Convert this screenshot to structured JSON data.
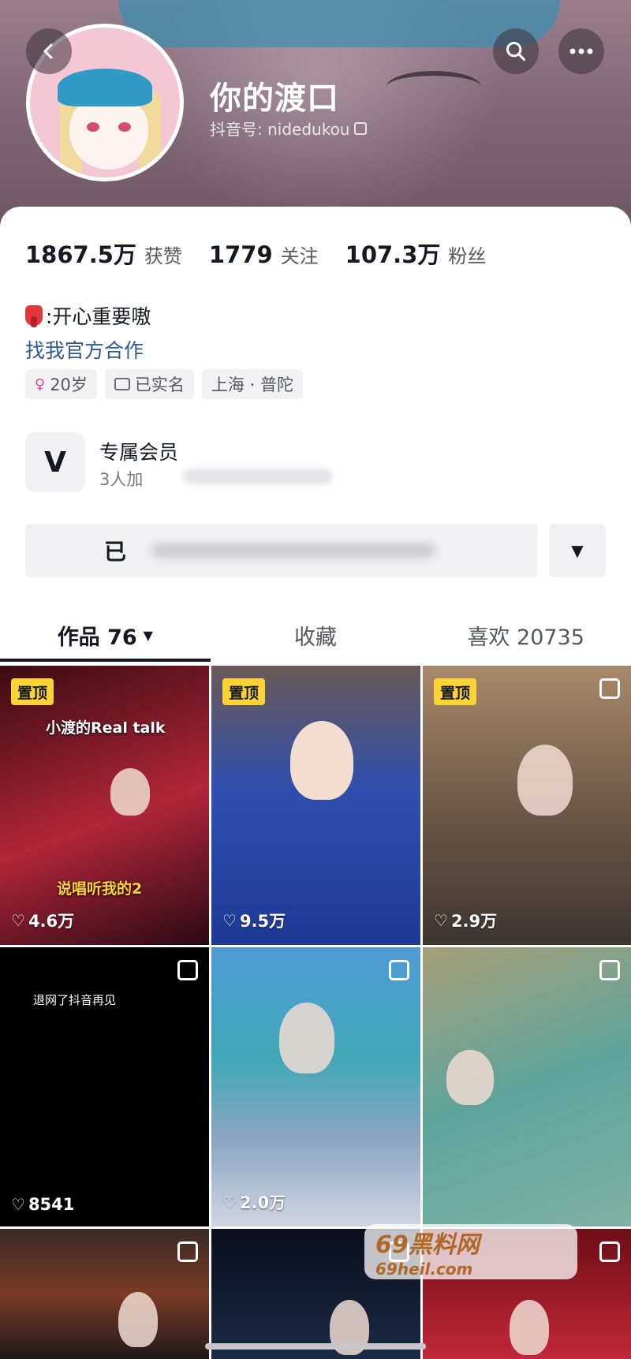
{
  "profile": {
    "name": "你的渡口",
    "douyin_id": "抖音号: nidedukou",
    "bio": ":开心重要嗷",
    "collab_link": "找我官方合作"
  },
  "stats": [
    {
      "num": "1867.5万",
      "label": "获赞"
    },
    {
      "num": "1779",
      "label": "关注"
    },
    {
      "num": "107.3万",
      "label": "粉丝"
    }
  ],
  "tags": {
    "age": "20岁",
    "verified": "已实名",
    "location": "上海 · 普陀"
  },
  "member": {
    "title": "专属会员",
    "subtitle": "3人加"
  },
  "action": {
    "main_label": "已"
  },
  "tabs": {
    "works": "作品 76",
    "collections": "收藏",
    "likes": "喜欢 20735"
  },
  "grid": {
    "pin_label": "置顶",
    "items": [
      {
        "likes": "4.6万",
        "caption": "小渡的Real talk",
        "caption2": "说唱听我的2"
      },
      {
        "likes": "9.5万"
      },
      {
        "likes": "2.9万"
      },
      {
        "likes": "8541",
        "caption": "退网了抖音再见"
      },
      {
        "likes": "2.0万"
      },
      {
        "likes": ""
      }
    ]
  },
  "watermark": {
    "title": "69黑料网",
    "url": "69heil.com"
  },
  "icons": {
    "back": "chevron-left-icon",
    "search": "search-icon",
    "more": "more-icon"
  }
}
